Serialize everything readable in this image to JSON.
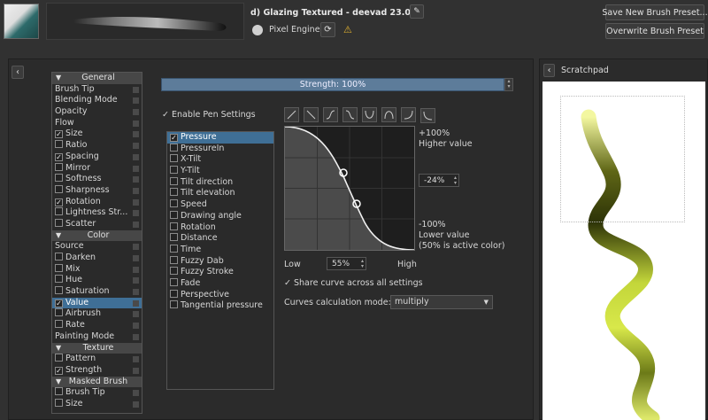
{
  "header": {
    "preset_name": "d) Glazing Textured - deevad 23.01",
    "engine_label": "Pixel Engine",
    "save_new_label": "Save New Brush Preset...",
    "overwrite_label": "Overwrite Brush Preset"
  },
  "options_list": [
    {
      "type": "header",
      "label": "General"
    },
    {
      "type": "item",
      "label": "Brush Tip",
      "checkbox": false
    },
    {
      "type": "item",
      "label": "Blending Mode",
      "checkbox": false
    },
    {
      "type": "item",
      "label": "Opacity",
      "checkbox": false
    },
    {
      "type": "item",
      "label": "Flow",
      "checkbox": false
    },
    {
      "type": "item",
      "label": "Size",
      "checkbox": true,
      "checked": true
    },
    {
      "type": "item",
      "label": "Ratio",
      "checkbox": true,
      "checked": false
    },
    {
      "type": "item",
      "label": "Spacing",
      "checkbox": true,
      "checked": true
    },
    {
      "type": "item",
      "label": "Mirror",
      "checkbox": true,
      "checked": false
    },
    {
      "type": "item",
      "label": "Softness",
      "checkbox": true,
      "checked": false
    },
    {
      "type": "item",
      "label": "Sharpness",
      "checkbox": true,
      "checked": false
    },
    {
      "type": "item",
      "label": "Rotation",
      "checkbox": true,
      "checked": true
    },
    {
      "type": "item",
      "label": "Lightness Str...",
      "checkbox": true,
      "checked": false
    },
    {
      "type": "item",
      "label": "Scatter",
      "checkbox": true,
      "checked": false
    },
    {
      "type": "header",
      "label": "Color"
    },
    {
      "type": "item",
      "label": "Source",
      "checkbox": false
    },
    {
      "type": "item",
      "label": "Darken",
      "checkbox": true,
      "checked": false
    },
    {
      "type": "item",
      "label": "Mix",
      "checkbox": true,
      "checked": false
    },
    {
      "type": "item",
      "label": "Hue",
      "checkbox": true,
      "checked": false
    },
    {
      "type": "item",
      "label": "Saturation",
      "checkbox": true,
      "checked": false
    },
    {
      "type": "item",
      "label": "Value",
      "checkbox": true,
      "checked": true,
      "selected": true
    },
    {
      "type": "item",
      "label": "Airbrush",
      "checkbox": true,
      "checked": false
    },
    {
      "type": "item",
      "label": "Rate",
      "checkbox": true,
      "checked": false
    },
    {
      "type": "item",
      "label": "Painting Mode",
      "checkbox": false
    },
    {
      "type": "header",
      "label": "Texture"
    },
    {
      "type": "item",
      "label": "Pattern",
      "checkbox": true,
      "checked": false
    },
    {
      "type": "item",
      "label": "Strength",
      "checkbox": true,
      "checked": true
    },
    {
      "type": "header",
      "label": "Masked Brush"
    },
    {
      "type": "item",
      "label": "Brush Tip",
      "checkbox": true,
      "checked": false
    },
    {
      "type": "item",
      "label": "Size",
      "checkbox": true,
      "checked": false
    }
  ],
  "strength_label": "Strength: 100%",
  "enable_pen_label": "Enable Pen Settings",
  "sensors": [
    {
      "label": "Pressure",
      "checked": true,
      "selected": true
    },
    {
      "label": "PressureIn",
      "checked": false
    },
    {
      "label": "X-Tilt",
      "checked": false
    },
    {
      "label": "Y-Tilt",
      "checked": false
    },
    {
      "label": "Tilt direction",
      "checked": false
    },
    {
      "label": "Tilt elevation",
      "checked": false
    },
    {
      "label": "Speed",
      "checked": false
    },
    {
      "label": "Drawing angle",
      "checked": false
    },
    {
      "label": "Rotation",
      "checked": false
    },
    {
      "label": "Distance",
      "checked": false
    },
    {
      "label": "Time",
      "checked": false
    },
    {
      "label": "Fuzzy Dab",
      "checked": false
    },
    {
      "label": "Fuzzy Stroke",
      "checked": false
    },
    {
      "label": "Fade",
      "checked": false
    },
    {
      "label": "Perspective",
      "checked": false
    },
    {
      "label": "Tangential pressure",
      "checked": false
    }
  ],
  "curve": {
    "top_label": "+100%",
    "higher_label": "Higher value",
    "offset_value": "-24%",
    "bottom_label": "-100%",
    "lower_label": "Lower value",
    "active_note": "(50% is active color)",
    "low_label": "Low",
    "high_label": "High",
    "input_value": "55%",
    "share_label": "Share curve across all settings",
    "mode_label": "Curves calculation mode:",
    "mode_value": "multiply"
  },
  "scratchpad": {
    "title": "Scratchpad"
  }
}
